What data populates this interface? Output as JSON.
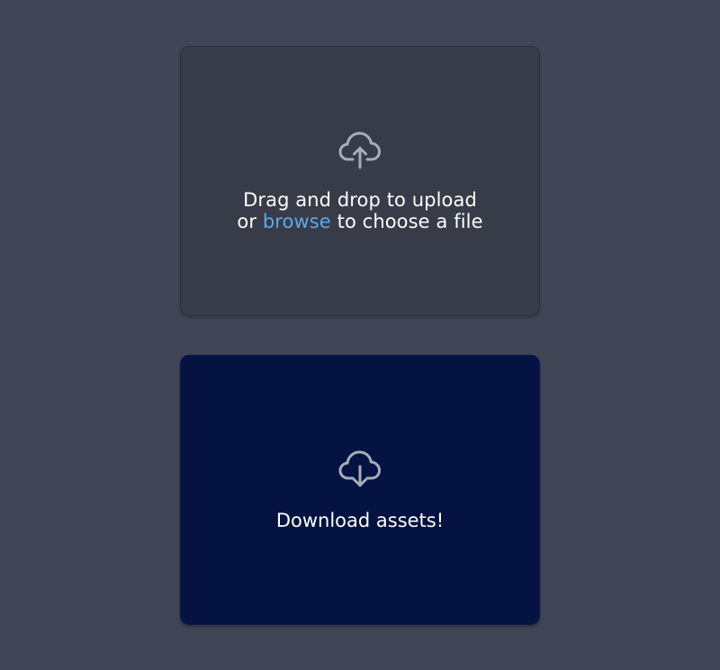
{
  "upload": {
    "icon": "cloud-upload-icon",
    "line1": "Drag and drop to upload",
    "line2_prefix": "or",
    "browse_link": "browse",
    "line2_suffix": "to choose a file"
  },
  "download": {
    "icon": "cloud-download-icon",
    "label": "Download assets!"
  },
  "colors": {
    "background": "#414656",
    "upload_card": "#383b48",
    "download_card": "#041342",
    "link": "#5aaaf0",
    "icon": "#a7adb9"
  }
}
